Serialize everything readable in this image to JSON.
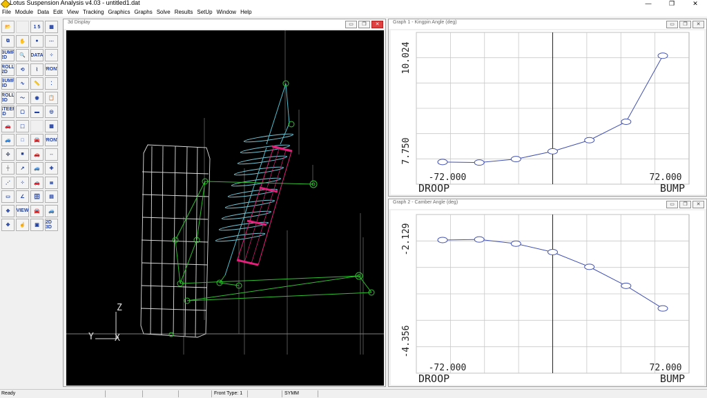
{
  "app": {
    "title": "Lotus Suspension Analysis v4.03 - untitled1.dat"
  },
  "menu": [
    "File",
    "Module",
    "Data",
    "Edit",
    "View",
    "Tracking",
    "Graphics",
    "Graphs",
    "Solve",
    "Results",
    "SetUp",
    "Window",
    "Help"
  ],
  "toolbar": {
    "buttons": [
      {
        "icon": "open-folder-icon",
        "label": "📂"
      },
      {
        "icon": "blank-icon",
        "label": ""
      },
      {
        "icon": "numbers-icon",
        "label": "1 5"
      },
      {
        "icon": "grid-view-icon",
        "label": "▦"
      },
      {
        "icon": "copy-files-icon",
        "label": "⧉"
      },
      {
        "icon": "hand-pan-icon",
        "label": "✋"
      },
      {
        "icon": "point-icon",
        "label": "●"
      },
      {
        "icon": "dots-icon",
        "label": "⋯"
      },
      {
        "icon": "bump-2d-icon",
        "label": "BUMP 2D"
      },
      {
        "icon": "zoom-icon",
        "label": "🔍"
      },
      {
        "icon": "data-list-icon",
        "label": "DATA"
      },
      {
        "icon": "scatter-icon",
        "label": "⁘"
      },
      {
        "icon": "roll-2d-icon",
        "label": "ROLL 2D"
      },
      {
        "icon": "rotate-icon",
        "label": "⟲"
      },
      {
        "icon": "spring-icon",
        "label": "⌇"
      },
      {
        "icon": "front-view-icon",
        "label": "FRONT"
      },
      {
        "icon": "bump-3d-icon",
        "label": "BUMP 3D"
      },
      {
        "icon": "curve-icon",
        "label": "∿"
      },
      {
        "icon": "ruler-icon",
        "label": "📏"
      },
      {
        "icon": "dim-icon",
        "label": "⁚"
      },
      {
        "icon": "roll-3d-icon",
        "label": "ROLL 3D"
      },
      {
        "icon": "wave-icon",
        "label": "〜"
      },
      {
        "icon": "wheel-icon",
        "label": "◉"
      },
      {
        "icon": "notes-icon",
        "label": "📋"
      },
      {
        "icon": "steer-3d-icon",
        "label": "STEER 3D"
      },
      {
        "icon": "cube-icon",
        "label": "▢"
      },
      {
        "icon": "link-icon",
        "label": "▬"
      },
      {
        "icon": "tyre-icon",
        "label": "◎"
      },
      {
        "icon": "car-front-icon",
        "label": "🚗"
      },
      {
        "icon": "box-icon",
        "label": "⬚"
      },
      {
        "icon": "blank-icon",
        "label": ""
      },
      {
        "icon": "grid-toggle-icon",
        "label": "▦"
      },
      {
        "icon": "car-side-icon",
        "label": "🚙"
      },
      {
        "icon": "box-outline-icon",
        "label": "□"
      },
      {
        "icon": "car-small-icon",
        "label": "🚘"
      },
      {
        "icon": "front-shape-icon",
        "label": "FRONT"
      },
      {
        "icon": "move-icon",
        "label": "✣"
      },
      {
        "icon": "green-cube-icon",
        "label": "■"
      },
      {
        "icon": "car-top-icon",
        "label": "🚗"
      },
      {
        "icon": "bump-shape-icon",
        "label": "↔"
      },
      {
        "icon": "axis-icon",
        "label": "┼"
      },
      {
        "icon": "coord-icon",
        "label": "↗"
      },
      {
        "icon": "car-rear-icon",
        "label": "🚙"
      },
      {
        "icon": "cross-icon",
        "label": "✚"
      },
      {
        "icon": "dotted-line-icon",
        "label": "⋰"
      },
      {
        "icon": "dotted-scatter-icon",
        "label": "⁘"
      },
      {
        "icon": "car-pair-icon",
        "label": "🚗"
      },
      {
        "icon": "stack-icon",
        "label": "≣"
      },
      {
        "icon": "screen-icon",
        "label": "▭"
      },
      {
        "icon": "angle-icon",
        "label": "∠"
      },
      {
        "icon": "database-icon",
        "label": "🗄"
      },
      {
        "icon": "dimensions-icon",
        "label": "▤"
      },
      {
        "icon": "pan-arrows-icon",
        "label": "✥"
      },
      {
        "icon": "view-icon",
        "label": "VIEW"
      },
      {
        "icon": "car-grey-icon",
        "label": "🚘"
      },
      {
        "icon": "car-arrow-icon",
        "label": "🚙"
      },
      {
        "icon": "move-arrows-icon",
        "label": "✥"
      },
      {
        "icon": "pointer-icon",
        "label": "☝"
      },
      {
        "icon": "stamp-icon",
        "label": "▣"
      },
      {
        "icon": "toggle-2d-3d-icon",
        "label": "2D 3D"
      }
    ]
  },
  "display3d": {
    "title": "3d Display",
    "axis_z": "Z",
    "axis_y": "Y",
    "axis_x": "X"
  },
  "graph1": {
    "title": "Graph 1 - Kingpin Angle (deg)",
    "y_top_label": "10.024",
    "y_bottom_label": "7.750",
    "x_left_label": "-72.000",
    "x_right_label": "72.000",
    "x_left_title": "DROOP",
    "x_right_title": "BUMP"
  },
  "graph2": {
    "title": "Graph 2 - Camber Angle (deg)",
    "y_top_label": "-2.129",
    "y_bottom_label": "-4.356",
    "x_left_label": "-72.000",
    "x_right_label": "72.000",
    "x_left_title": "DROOP",
    "x_right_title": "BUMP"
  },
  "chart_data": [
    {
      "type": "line",
      "title": "Graph 1 - Kingpin Angle (deg)",
      "xlabel": "DROOP / BUMP",
      "x": [
        -72,
        -48,
        -24,
        0,
        24,
        48,
        72
      ],
      "series": [
        {
          "values": [
            7.78,
            7.77,
            7.84,
            8.0,
            8.23,
            8.61,
            9.97
          ]
        }
      ],
      "xlim": [
        -72,
        72
      ],
      "ylim": [
        7.75,
        10.024
      ],
      "grid": true
    },
    {
      "type": "line",
      "title": "Graph 2 - Camber Angle (deg)",
      "xlabel": "DROOP / BUMP",
      "x": [
        -72,
        -48,
        -24,
        0,
        24,
        48,
        72
      ],
      "series": [
        {
          "values": [
            -2.22,
            -2.21,
            -2.29,
            -2.45,
            -2.73,
            -3.09,
            -3.52
          ]
        }
      ],
      "xlim": [
        -72,
        72
      ],
      "ylim": [
        -4.356,
        -2.129
      ],
      "grid": true
    }
  ],
  "status": {
    "ready": "Ready",
    "front_type": "Front Type: 1",
    "symm": "SYMM"
  }
}
